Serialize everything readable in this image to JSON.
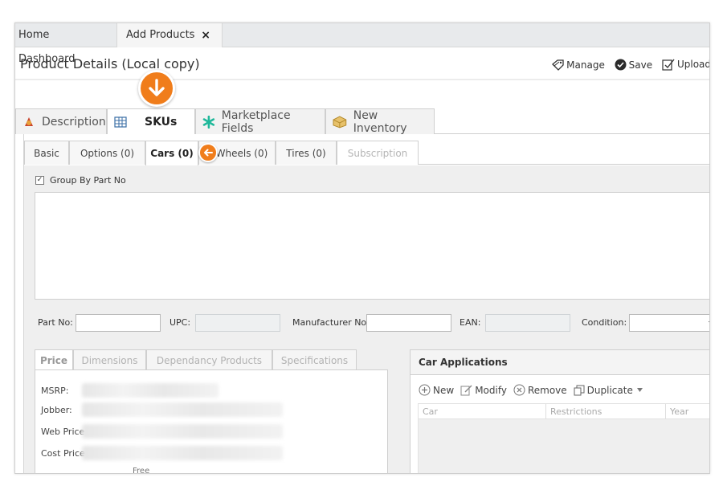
{
  "window_tabs": {
    "home": "Home Dashboard",
    "add_products": "Add Products",
    "close_symbol": "×"
  },
  "header": {
    "title": "Product Details (Local copy)",
    "toolbar": {
      "manage": "Manage",
      "save": "Save",
      "upload": "Upload"
    }
  },
  "main_tabs": [
    {
      "label": "Description",
      "icon": "description-icon"
    },
    {
      "label": "SKUs",
      "icon": "grid-icon",
      "active": true
    },
    {
      "label": "Marketplace Fields",
      "icon": "asterisk-icon"
    },
    {
      "label": "New Inventory",
      "icon": "box-icon"
    }
  ],
  "sub_tabs": [
    {
      "label": "Basic"
    },
    {
      "label": "Options (0)"
    },
    {
      "label": "Cars (0)",
      "active": true
    },
    {
      "label": "Wheels (0)"
    },
    {
      "label": "Tires (0)"
    },
    {
      "label": "Subscription",
      "disabled": true
    }
  ],
  "group_by": {
    "label": "Group By Part No",
    "checked": true,
    "check_glyph": "✓"
  },
  "fields": {
    "part_no": "Part No:",
    "upc": "UPC:",
    "manufacturer_no": "Manufacturer No:",
    "ean": "EAN:",
    "condition": "Condition:"
  },
  "lower_tabs": [
    {
      "label": "Price",
      "active": true
    },
    {
      "label": "Dimensions"
    },
    {
      "label": "Dependancy Products"
    },
    {
      "label": "Specifications"
    }
  ],
  "price_labels": [
    "MSRP:",
    "Jobber:",
    "Web Price",
    "Cost Price"
  ],
  "price_free": "Free",
  "car_applications": {
    "title": "Car Applications",
    "tools": {
      "new": "New",
      "modify": "Modify",
      "remove": "Remove",
      "duplicate": "Duplicate"
    },
    "columns": [
      "Car",
      "Restrictions",
      "Year"
    ]
  },
  "colors": {
    "accent": "#f07d1b",
    "tab_border": "#cfcfcf",
    "panel_gray": "#efefef"
  }
}
